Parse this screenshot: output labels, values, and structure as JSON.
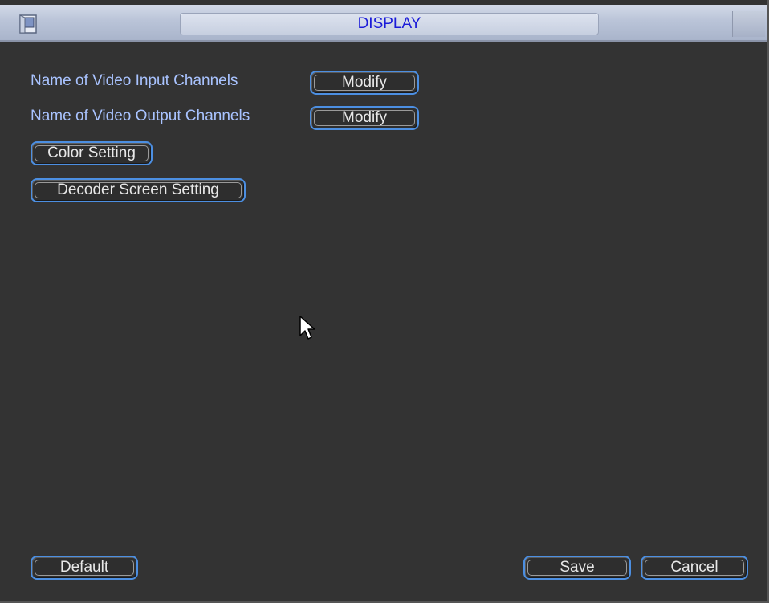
{
  "window": {
    "title": "DISPLAY",
    "icon": "window-icon"
  },
  "rows": [
    {
      "label": "Name of Video Input Channels",
      "button": "Modify"
    },
    {
      "label": "Name of Video Output Channels",
      "button": "Modify"
    }
  ],
  "buttons": {
    "color_setting": "Color Setting",
    "decoder_screen_setting": "Decoder Screen Setting",
    "default": "Default",
    "save": "Save",
    "cancel": "Cancel"
  },
  "colors": {
    "title_text": "#1b1bd8",
    "label_text": "#a9c3ff",
    "button_border": "#4c8fe2",
    "background": "#333333"
  },
  "cursor": "pointer-arrow-icon"
}
